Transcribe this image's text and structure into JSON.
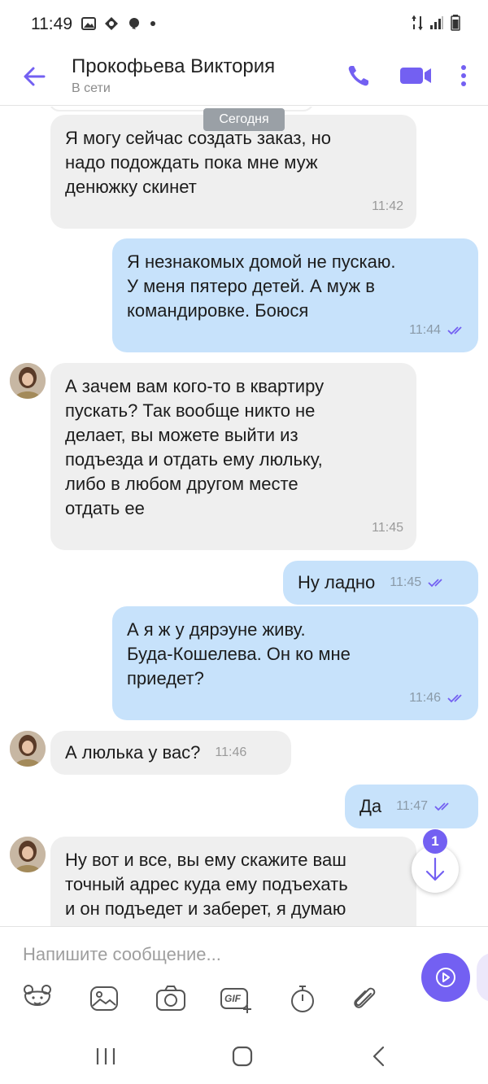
{
  "status_bar": {
    "time": "11:49"
  },
  "header": {
    "contact_name": "Прокофьева Виктория",
    "contact_status": "В сети"
  },
  "chat": {
    "date_separator": "Сегодня",
    "messages": [
      {
        "direction": "in",
        "text": "Я могу сейчас создать заказ, но\nнадо подождать пока мне муж\nденюжку скинет",
        "time": "11:42"
      },
      {
        "direction": "out",
        "text": "Я незнакомых домой не пускаю.\nУ меня пятеро детей. А муж в\nкомандировке. Боюся",
        "time": "11:44"
      },
      {
        "direction": "in",
        "text": "А зачем вам кого-то в квартиру\nпускать? Так вообще никто не\nделает, вы можете выйти из\nподъезда и отдать ему люльку,\nлибо в любом другом месте\nотдать ее",
        "time": "11:45"
      },
      {
        "direction": "out",
        "text": "Ну ладно",
        "time": "11:45"
      },
      {
        "direction": "out",
        "text": "А я ж у дярэуне живу.\nБуда-Кошелева. Он ко мне\nприедет?",
        "time": "11:46"
      },
      {
        "direction": "in",
        "text": "А люлька у вас?",
        "time": "11:46"
      },
      {
        "direction": "out",
        "text": "Да",
        "time": "11:47"
      },
      {
        "direction": "in",
        "text": "Ну вот и все, вы ему скажите ваш\nточный адрес куда ему подъехать\nи он подъедет и заберет, я думаю"
      }
    ],
    "unread_count": "1"
  },
  "composer": {
    "placeholder": "Напишите сообщение...",
    "gif_label": "GIF",
    "tools": [
      "sticker-icon",
      "gallery-icon",
      "camera-icon",
      "gif-icon",
      "timer-icon",
      "attachment-icon"
    ]
  },
  "colors": {
    "accent": "#7360f2",
    "incoming_bubble": "#efefef",
    "outgoing_bubble": "#c7e2fb",
    "read_ticks": "#7360f2"
  }
}
